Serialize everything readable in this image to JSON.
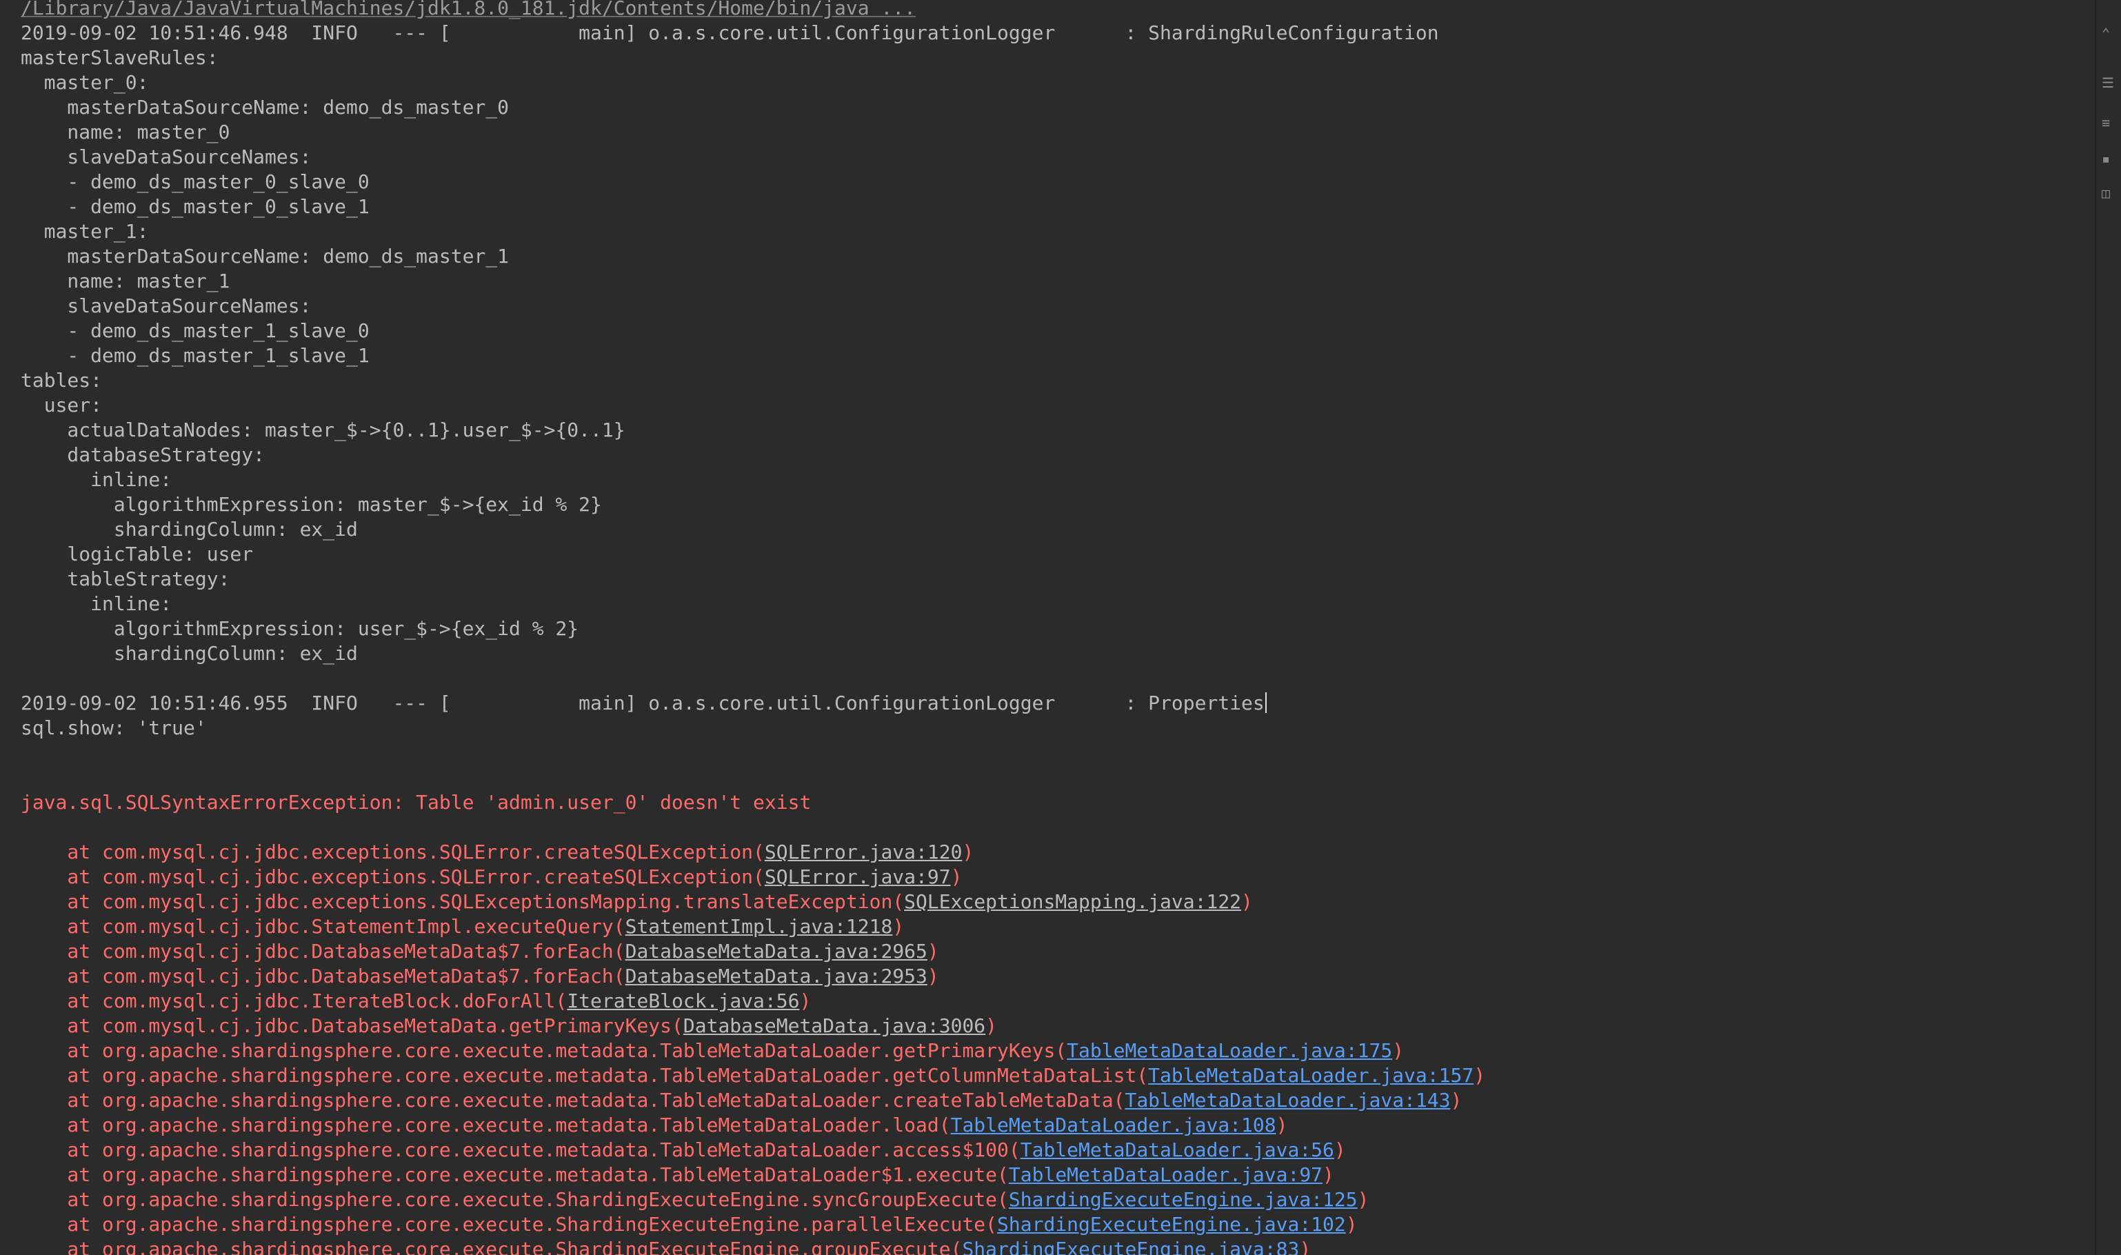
{
  "console": {
    "lines": [
      {
        "kind": "cmd",
        "parts": [
          {
            "t": "/Library/Java/JavaVirtualMachines/jdk1.8.0_181.jdk/Contents/Home/bin/java ..."
          }
        ]
      },
      {
        "kind": "info",
        "parts": [
          {
            "t": "2019-09-02 10:51:46.948  INFO   --- [           main] o.a.s.core.util.ConfigurationLogger      : ShardingRuleConfiguration"
          }
        ]
      },
      {
        "kind": "info",
        "parts": [
          {
            "t": "masterSlaveRules:"
          }
        ]
      },
      {
        "kind": "info",
        "parts": [
          {
            "t": "  master_0:"
          }
        ]
      },
      {
        "kind": "info",
        "parts": [
          {
            "t": "    masterDataSourceName: demo_ds_master_0"
          }
        ]
      },
      {
        "kind": "info",
        "parts": [
          {
            "t": "    name: master_0"
          }
        ]
      },
      {
        "kind": "info",
        "parts": [
          {
            "t": "    slaveDataSourceNames:"
          }
        ]
      },
      {
        "kind": "info",
        "parts": [
          {
            "t": "    - demo_ds_master_0_slave_0"
          }
        ]
      },
      {
        "kind": "info",
        "parts": [
          {
            "t": "    - demo_ds_master_0_slave_1"
          }
        ]
      },
      {
        "kind": "info",
        "parts": [
          {
            "t": "  master_1:"
          }
        ]
      },
      {
        "kind": "info",
        "parts": [
          {
            "t": "    masterDataSourceName: demo_ds_master_1"
          }
        ]
      },
      {
        "kind": "info",
        "parts": [
          {
            "t": "    name: master_1"
          }
        ]
      },
      {
        "kind": "info",
        "parts": [
          {
            "t": "    slaveDataSourceNames:"
          }
        ]
      },
      {
        "kind": "info",
        "parts": [
          {
            "t": "    - demo_ds_master_1_slave_0"
          }
        ]
      },
      {
        "kind": "info",
        "parts": [
          {
            "t": "    - demo_ds_master_1_slave_1"
          }
        ]
      },
      {
        "kind": "info",
        "parts": [
          {
            "t": "tables:"
          }
        ]
      },
      {
        "kind": "info",
        "parts": [
          {
            "t": "  user:"
          }
        ]
      },
      {
        "kind": "info",
        "parts": [
          {
            "t": "    actualDataNodes: master_$->{0..1}.user_$->{0..1}"
          }
        ]
      },
      {
        "kind": "info",
        "parts": [
          {
            "t": "    databaseStrategy:"
          }
        ]
      },
      {
        "kind": "info",
        "parts": [
          {
            "t": "      inline:"
          }
        ]
      },
      {
        "kind": "info",
        "parts": [
          {
            "t": "        algorithmExpression: master_$->{ex_id % 2}"
          }
        ]
      },
      {
        "kind": "info",
        "parts": [
          {
            "t": "        shardingColumn: ex_id"
          }
        ]
      },
      {
        "kind": "info",
        "parts": [
          {
            "t": "    logicTable: user"
          }
        ]
      },
      {
        "kind": "info",
        "parts": [
          {
            "t": "    tableStrategy:"
          }
        ]
      },
      {
        "kind": "info",
        "parts": [
          {
            "t": "      inline:"
          }
        ]
      },
      {
        "kind": "info",
        "parts": [
          {
            "t": "        algorithmExpression: user_$->{ex_id % 2}"
          }
        ]
      },
      {
        "kind": "info",
        "parts": [
          {
            "t": "        shardingColumn: ex_id"
          }
        ]
      },
      {
        "kind": "blank",
        "parts": []
      },
      {
        "kind": "info",
        "caret": true,
        "parts": [
          {
            "t": "2019-09-02 10:51:46.955  INFO   --- [           main] o.a.s.core.util.ConfigurationLogger      : Properties"
          }
        ]
      },
      {
        "kind": "info",
        "parts": [
          {
            "t": "sql.show: 'true'"
          }
        ]
      },
      {
        "kind": "blank",
        "parts": []
      },
      {
        "kind": "blank",
        "parts": []
      },
      {
        "kind": "err",
        "parts": [
          {
            "t": "java.sql.SQLSyntaxErrorException: Table 'admin.user_0' doesn't exist"
          }
        ]
      },
      {
        "kind": "blank",
        "parts": []
      },
      {
        "kind": "err",
        "parts": [
          {
            "t": "    at com.mysql.cj.jdbc.exceptions.SQLError.createSQLException("
          },
          {
            "t": "SQLError.java:120",
            "link": "gray"
          },
          {
            "t": ")"
          }
        ]
      },
      {
        "kind": "err",
        "parts": [
          {
            "t": "    at com.mysql.cj.jdbc.exceptions.SQLError.createSQLException("
          },
          {
            "t": "SQLError.java:97",
            "link": "gray"
          },
          {
            "t": ")"
          }
        ]
      },
      {
        "kind": "err",
        "parts": [
          {
            "t": "    at com.mysql.cj.jdbc.exceptions.SQLExceptionsMapping.translateException("
          },
          {
            "t": "SQLExceptionsMapping.java:122",
            "link": "gray"
          },
          {
            "t": ")"
          }
        ]
      },
      {
        "kind": "err",
        "parts": [
          {
            "t": "    at com.mysql.cj.jdbc.StatementImpl.executeQuery("
          },
          {
            "t": "StatementImpl.java:1218",
            "link": "gray"
          },
          {
            "t": ")"
          }
        ]
      },
      {
        "kind": "err",
        "parts": [
          {
            "t": "    at com.mysql.cj.jdbc.DatabaseMetaData$7.forEach("
          },
          {
            "t": "DatabaseMetaData.java:2965",
            "link": "gray"
          },
          {
            "t": ")"
          }
        ]
      },
      {
        "kind": "err",
        "parts": [
          {
            "t": "    at com.mysql.cj.jdbc.DatabaseMetaData$7.forEach("
          },
          {
            "t": "DatabaseMetaData.java:2953",
            "link": "gray"
          },
          {
            "t": ")"
          }
        ]
      },
      {
        "kind": "err",
        "parts": [
          {
            "t": "    at com.mysql.cj.jdbc.IterateBlock.doForAll("
          },
          {
            "t": "IterateBlock.java:56",
            "link": "gray"
          },
          {
            "t": ")"
          }
        ]
      },
      {
        "kind": "err",
        "parts": [
          {
            "t": "    at com.mysql.cj.jdbc.DatabaseMetaData.getPrimaryKeys("
          },
          {
            "t": "DatabaseMetaData.java:3006",
            "link": "gray"
          },
          {
            "t": ")"
          }
        ]
      },
      {
        "kind": "err",
        "parts": [
          {
            "t": "    at org.apache.shardingsphere.core.execute.metadata.TableMetaDataLoader.getPrimaryKeys("
          },
          {
            "t": "TableMetaDataLoader.java:175",
            "link": "blue"
          },
          {
            "t": ")"
          }
        ]
      },
      {
        "kind": "err",
        "parts": [
          {
            "t": "    at org.apache.shardingsphere.core.execute.metadata.TableMetaDataLoader.getColumnMetaDataList("
          },
          {
            "t": "TableMetaDataLoader.java:157",
            "link": "blue"
          },
          {
            "t": ")"
          }
        ]
      },
      {
        "kind": "err",
        "parts": [
          {
            "t": "    at org.apache.shardingsphere.core.execute.metadata.TableMetaDataLoader.createTableMetaData("
          },
          {
            "t": "TableMetaDataLoader.java:143",
            "link": "blue"
          },
          {
            "t": ")"
          }
        ]
      },
      {
        "kind": "err",
        "parts": [
          {
            "t": "    at org.apache.shardingsphere.core.execute.metadata.TableMetaDataLoader.load("
          },
          {
            "t": "TableMetaDataLoader.java:108",
            "link": "blue"
          },
          {
            "t": ")"
          }
        ]
      },
      {
        "kind": "err",
        "parts": [
          {
            "t": "    at org.apache.shardingsphere.core.execute.metadata.TableMetaDataLoader.access$100("
          },
          {
            "t": "TableMetaDataLoader.java:56",
            "link": "blue"
          },
          {
            "t": ")"
          }
        ]
      },
      {
        "kind": "err",
        "parts": [
          {
            "t": "    at org.apache.shardingsphere.core.execute.metadata.TableMetaDataLoader$1.execute("
          },
          {
            "t": "TableMetaDataLoader.java:97",
            "link": "blue"
          },
          {
            "t": ")"
          }
        ]
      },
      {
        "kind": "err",
        "parts": [
          {
            "t": "    at org.apache.shardingsphere.core.execute.ShardingExecuteEngine.syncGroupExecute("
          },
          {
            "t": "ShardingExecuteEngine.java:125",
            "link": "blue"
          },
          {
            "t": ")"
          }
        ]
      },
      {
        "kind": "err",
        "parts": [
          {
            "t": "    at org.apache.shardingsphere.core.execute.ShardingExecuteEngine.parallelExecute("
          },
          {
            "t": "ShardingExecuteEngine.java:102",
            "link": "blue"
          },
          {
            "t": ")"
          }
        ]
      },
      {
        "kind": "err",
        "parts": [
          {
            "t": "    at org.apache.shardingsphere.core.execute.ShardingExecuteEngine.groupExecute("
          },
          {
            "t": "ShardingExecuteEngine.java:83",
            "link": "blue"
          },
          {
            "t": ")"
          }
        ]
      }
    ]
  },
  "gutter": {
    "icons": [
      "scroll-up-icon",
      "soft-wrap-icon",
      "scroll-to-end-icon",
      "print-icon",
      "clear-all-icon"
    ]
  },
  "colors": {
    "background": "#2b2b2b",
    "text": "#bbbbbb",
    "error": "#ff6b68",
    "link": "#589df6"
  }
}
